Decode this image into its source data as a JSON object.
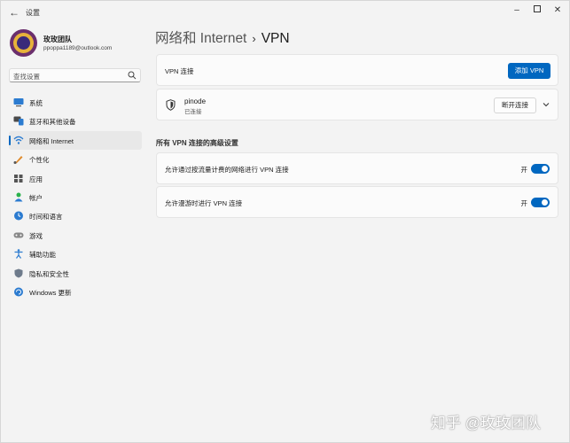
{
  "window": {
    "title": "设置",
    "back_icon": "back-arrow-icon",
    "controls": [
      "minimize-icon",
      "maximize-icon",
      "close-icon"
    ]
  },
  "profile": {
    "name": "玫玫团队",
    "email": "ppoppa1189@outlook.com"
  },
  "search": {
    "placeholder": "查找设置",
    "icon": "search-icon"
  },
  "sidebar": {
    "items": [
      {
        "label": "系统",
        "icon": "system-icon",
        "active": false
      },
      {
        "label": "蓝牙和其他设备",
        "icon": "bluetooth-icon",
        "active": false
      },
      {
        "label": "网络和 Internet",
        "icon": "network-icon",
        "active": true
      },
      {
        "label": "个性化",
        "icon": "personalization-icon",
        "active": false
      },
      {
        "label": "应用",
        "icon": "apps-icon",
        "active": false
      },
      {
        "label": "帐户",
        "icon": "account-icon",
        "active": false
      },
      {
        "label": "时间和语言",
        "icon": "time-language-icon",
        "active": false
      },
      {
        "label": "游戏",
        "icon": "gaming-icon",
        "active": false
      },
      {
        "label": "辅助功能",
        "icon": "accessibility-icon",
        "active": false
      },
      {
        "label": "隐私和安全性",
        "icon": "privacy-icon",
        "active": false
      },
      {
        "label": "Windows 更新",
        "icon": "update-icon",
        "active": false
      }
    ]
  },
  "breadcrumb": {
    "parent": "网络和 Internet",
    "separator": "›",
    "current": "VPN"
  },
  "vpn": {
    "header_label": "VPN 连接",
    "add_button": "添加 VPN",
    "connection": {
      "name": "pinode",
      "status": "已连接",
      "disconnect_button": "断开连接"
    }
  },
  "advanced": {
    "title": "所有 VPN 连接的高级设置",
    "options": [
      {
        "label": "允许通过按流量计费的网络进行 VPN 连接",
        "state_text": "开",
        "on": true
      },
      {
        "label": "允许漫游时进行 VPN 连接",
        "state_text": "开",
        "on": true
      }
    ]
  },
  "watermark": "知乎 @玫玫团队",
  "colors": {
    "accent": "#0067c0",
    "background": "#f3f3f3",
    "card": "#fbfbfb"
  }
}
